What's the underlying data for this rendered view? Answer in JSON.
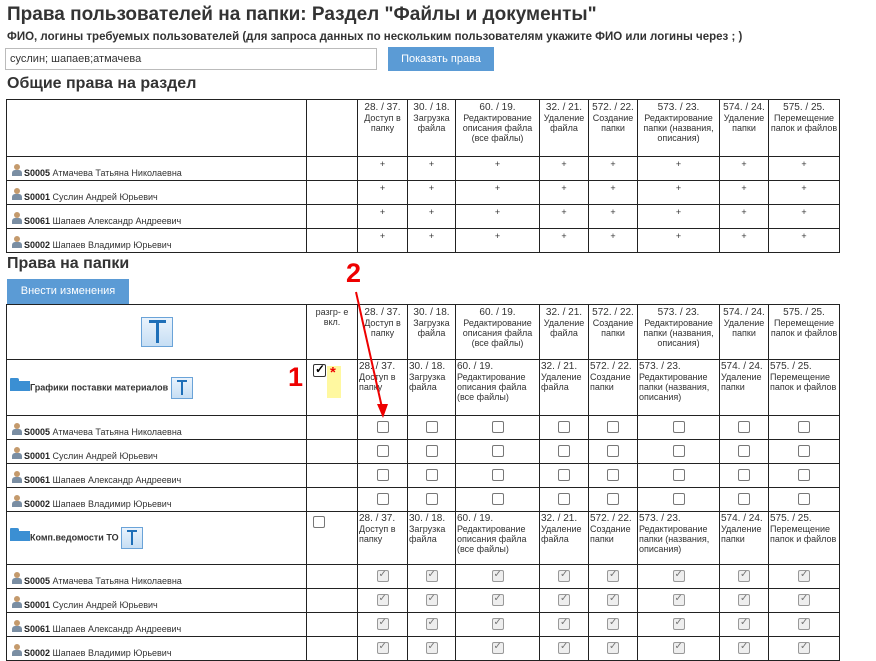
{
  "page": {
    "title": "Права пользователей на папки: Раздел \"Файлы и документы\"",
    "instruction": "ФИО, логины требуемых пользователей (для запроса данных по нескольким пользователям укажите ФИО или логины через ; )",
    "search_value": "суслин; шапаев;атмачева",
    "show_button": "Показать права",
    "general_section_title": "Общие права на раздел",
    "folders_section_title": "Права на папки",
    "apply_button": "Внести изменения",
    "resolve_header": "разгр- е вкл."
  },
  "permissions": [
    {
      "num": "28. / 37.",
      "label": "Доступ в папку"
    },
    {
      "num": "30. / 18.",
      "label": "Загрузка файла"
    },
    {
      "num": "60. / 19.",
      "label": "Редактирование описания файла (все файлы)"
    },
    {
      "num": "32. / 21.",
      "label": "Удаление файла"
    },
    {
      "num": "572. / 22.",
      "label": "Создание папки"
    },
    {
      "num": "573. / 23.",
      "label": "Редактирование папки (названия, описания)"
    },
    {
      "num": "574. / 24.",
      "label": "Удаление папки"
    },
    {
      "num": "575. / 25.",
      "label": "Перемещение папок и файлов"
    }
  ],
  "users": [
    {
      "id": "S0005",
      "name": "Атмачева Татьяна Николаевна"
    },
    {
      "id": "S0001",
      "name": "Суслин Андрей Юрьевич"
    },
    {
      "id": "S0061",
      "name": "Шапаев Александр Андреевич"
    },
    {
      "id": "S0002",
      "name": "Шапаев Владимир Юрьевич"
    }
  ],
  "plus_mark": "+",
  "folders": [
    {
      "name": "Графики поставки материалов",
      "checked": true,
      "marker": "*"
    },
    {
      "name": "Комп.ведомости ТО",
      "checked": false
    }
  ],
  "annotations": {
    "marker_1": "1",
    "marker_2": "2"
  },
  "colors": {
    "button_bg": "#5b9bd5",
    "annotation": "#ee0000",
    "folder": "#3b8fd3",
    "highlight": "#fff8a0"
  }
}
